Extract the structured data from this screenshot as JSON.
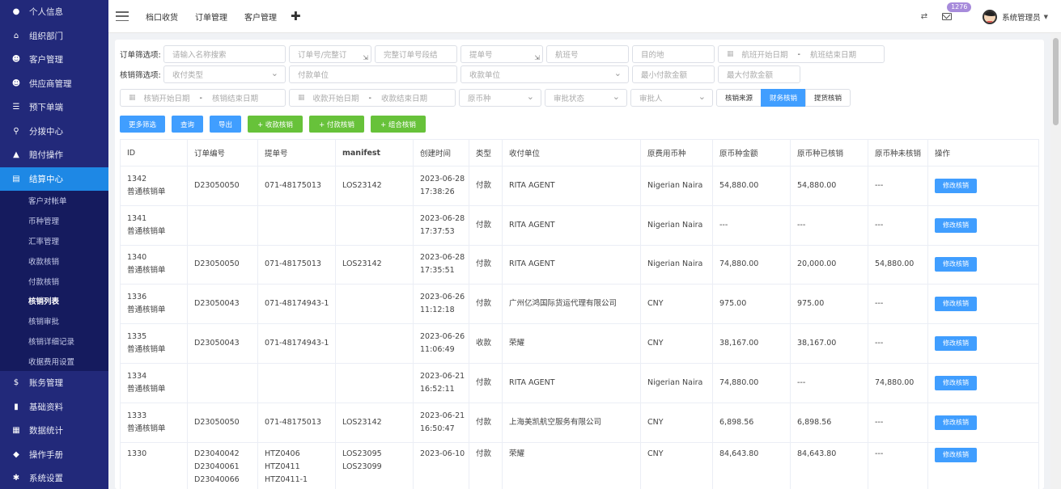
{
  "sidebar": {
    "items": [
      {
        "label": "个人信息",
        "icon": "user-icon"
      },
      {
        "label": "组织部门",
        "icon": "bank-icon"
      },
      {
        "label": "客户管理",
        "icon": "users-icon"
      },
      {
        "label": "供应商管理",
        "icon": "users-icon"
      },
      {
        "label": "预下单端",
        "icon": "list-icon"
      },
      {
        "label": "分拨中心",
        "icon": "location-icon"
      },
      {
        "label": "赔付操作",
        "icon": "warning-icon"
      },
      {
        "label": "结算中心",
        "icon": "calculator-icon"
      }
    ],
    "sub_items": [
      "客户对帐单",
      "币种管理",
      "汇率管理",
      "收款核销",
      "付款核销",
      "核销列表",
      "核销审批",
      "核销详细记录",
      "收据费用设置"
    ],
    "bottom_items": [
      {
        "label": "账务管理",
        "icon": "dollar-icon"
      },
      {
        "label": "基础资料",
        "icon": "file-icon"
      },
      {
        "label": "数据统计",
        "icon": "chart-icon"
      },
      {
        "label": "操作手册",
        "icon": "tag-icon"
      },
      {
        "label": "系统设置",
        "icon": "gear-icon"
      }
    ]
  },
  "header": {
    "nav": [
      "档口收货",
      "订单管理",
      "客户管理"
    ],
    "badge_count": "1276",
    "user_name": "系统管理员"
  },
  "filters": {
    "order_label": "订单筛选项:",
    "verify_label": "核销筛选项:",
    "name_placeholder": "请输入名称搜索",
    "order_no_placeholder": "订单号/完整订",
    "full_order_placeholder": "完整订单号段结",
    "bill_placeholder": "提单号",
    "flight_placeholder": "航班号",
    "dest_placeholder": "目的地",
    "flight_start": "航班开始日期",
    "flight_end": "航班结束日期",
    "pay_type": "收付类型",
    "pay_unit": "付款单位",
    "recv_unit": "收款单位",
    "min_amount": "最小付款金额",
    "max_amount": "最大付款金额",
    "verify_start": "核销开始日期",
    "verify_end": "核销结束日期",
    "recv_start": "收款开始日期",
    "recv_end": "收款结束日期",
    "currency": "原币种",
    "audit_status": "审批状态",
    "auditor": "审批人",
    "seg": [
      "核销来源",
      "财务核销",
      "提货核销"
    ],
    "seg_active": 1
  },
  "buttons": {
    "more": "更多筛选",
    "query": "查询",
    "export": "导出",
    "recv_verify": "+ 收款核销",
    "pay_verify": "+ 付款核销",
    "combo_verify": "+ 组合核销"
  },
  "table": {
    "headers": [
      "ID",
      "订单编号",
      "提单号",
      "manifest",
      "创建时间",
      "类型",
      "收付单位",
      "原费用币种",
      "原币种金额",
      "原币种已核销",
      "原币种未核销",
      "操作"
    ],
    "action_label": "修改核销",
    "rows": [
      {
        "id": "1342",
        "kind": "普通核销单",
        "order": [
          "D23050050"
        ],
        "bill": [
          "071-48175013"
        ],
        "manifest": [
          "LOS23142"
        ],
        "date": "2023-06-28",
        "time": "17:38:26",
        "type": "付款",
        "unit": "RITA AGENT",
        "currency": "Nigerian Naira",
        "amount": "54,880.00",
        "verified": "54,880.00",
        "unverified": "---"
      },
      {
        "id": "1341",
        "kind": "普通核销单",
        "order": [],
        "bill": [],
        "manifest": [],
        "date": "2023-06-28",
        "time": "17:37:53",
        "type": "付款",
        "unit": "RITA AGENT",
        "currency": "Nigerian Naira",
        "amount": "---",
        "verified": "---",
        "unverified": "---"
      },
      {
        "id": "1340",
        "kind": "普通核销单",
        "order": [
          "D23050050"
        ],
        "bill": [
          "071-48175013"
        ],
        "manifest": [
          "LOS23142"
        ],
        "date": "2023-06-28",
        "time": "17:35:51",
        "type": "付款",
        "unit": "RITA AGENT",
        "currency": "Nigerian Naira",
        "amount": "74,880.00",
        "verified": "20,000.00",
        "unverified": "54,880.00"
      },
      {
        "id": "1336",
        "kind": "普通核销单",
        "order": [
          "D23050043"
        ],
        "bill": [
          "071-48174943-1"
        ],
        "manifest": [],
        "date": "2023-06-26",
        "time": "11:12:18",
        "type": "付款",
        "unit": "广州亿鸿国际货运代理有限公司",
        "currency": "CNY",
        "amount": "975.00",
        "verified": "975.00",
        "unverified": "---"
      },
      {
        "id": "1335",
        "kind": "普通核销单",
        "order": [
          "D23050043"
        ],
        "bill": [
          "071-48174943-1"
        ],
        "manifest": [],
        "date": "2023-06-26",
        "time": "11:06:49",
        "type": "收款",
        "unit": "荣耀",
        "currency": "CNY",
        "amount": "38,167.00",
        "verified": "38,167.00",
        "unverified": "---"
      },
      {
        "id": "1334",
        "kind": "普通核销单",
        "order": [],
        "bill": [],
        "manifest": [],
        "date": "2023-06-21",
        "time": "16:52:11",
        "type": "付款",
        "unit": "RITA AGENT",
        "currency": "Nigerian Naira",
        "amount": "74,880.00",
        "verified": "---",
        "unverified": "74,880.00"
      },
      {
        "id": "1333",
        "kind": "普通核销单",
        "order": [
          "D23050050"
        ],
        "bill": [
          "071-48175013"
        ],
        "manifest": [
          "LOS23142"
        ],
        "date": "2023-06-21",
        "time": "16:50:47",
        "type": "付款",
        "unit": "上海美凯航空服务有限公司",
        "currency": "CNY",
        "amount": "6,898.56",
        "verified": "6,898.56",
        "unverified": "---"
      },
      {
        "id": "1330",
        "kind": "",
        "order": [
          "D23040042",
          "D23040061",
          "D23040066"
        ],
        "bill": [
          "HTZ0406",
          "HTZ0411",
          "HTZ0411-1"
        ],
        "manifest": [
          "LOS23095",
          "",
          "LOS23099"
        ],
        "date": "2023-06-10",
        "time": "",
        "type": "付款",
        "unit": "荣耀",
        "currency": "CNY",
        "amount": "84,643.80",
        "verified": "84,643.80",
        "unverified": "---"
      }
    ]
  }
}
